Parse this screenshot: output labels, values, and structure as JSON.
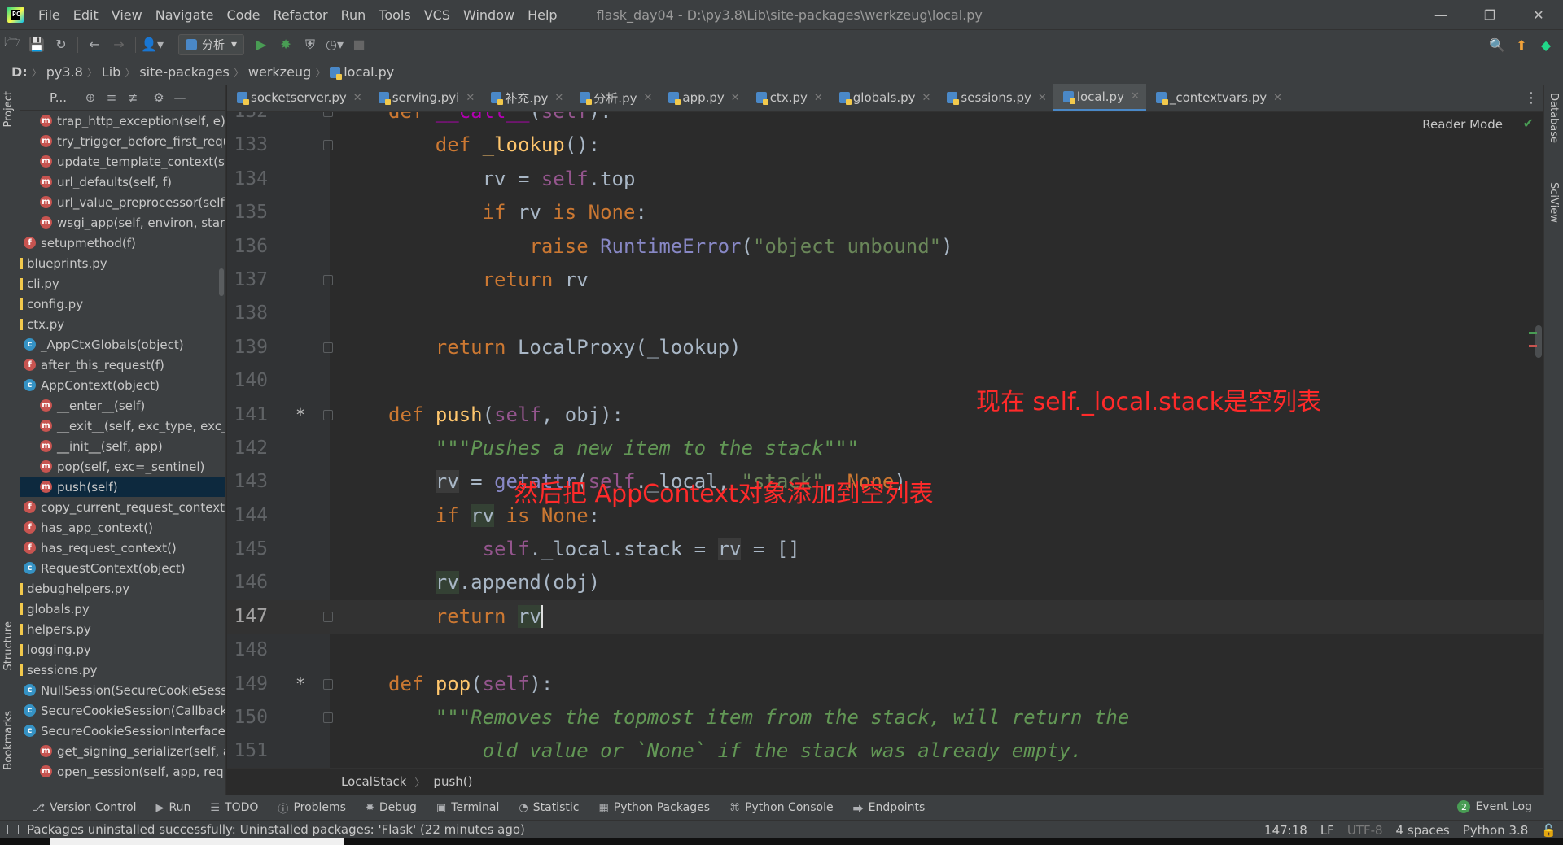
{
  "window": {
    "menu": [
      "File",
      "Edit",
      "View",
      "Navigate",
      "Code",
      "Refactor",
      "Run",
      "Tools",
      "VCS",
      "Window",
      "Help"
    ],
    "title": "flask_day04 - D:\\py3.8\\Lib\\site-packages\\werkzeug\\local.py",
    "logo_text": "PC"
  },
  "toolbar": {
    "run_config": "分析",
    "icons": [
      "open-icon",
      "save-icon",
      "sync-icon",
      "back-icon",
      "forward-icon",
      "user-icon",
      "run-icon",
      "debug-icon",
      "coverage-icon",
      "profile-icon",
      "stop-icon",
      "search-icon",
      "update-icon",
      "jetbrains-icon"
    ]
  },
  "navpath": {
    "crumbs": [
      "D:",
      "py3.8",
      "Lib",
      "site-packages",
      "werkzeug",
      "local.py"
    ]
  },
  "left_strip": {
    "project": "Project",
    "structure": "Structure",
    "bookmarks": "Bookmarks"
  },
  "project": {
    "header": "P...",
    "tree": [
      {
        "type": "m",
        "indent": 2,
        "label": "trap_http_exception(self, e)"
      },
      {
        "type": "m",
        "indent": 2,
        "label": "try_trigger_before_first_request"
      },
      {
        "type": "m",
        "indent": 2,
        "label": "update_template_context(self"
      },
      {
        "type": "m",
        "indent": 2,
        "label": "url_defaults(self, f)"
      },
      {
        "type": "m",
        "indent": 2,
        "label": "url_value_preprocessor(self"
      },
      {
        "type": "m",
        "indent": 2,
        "label": "wsgi_app(self, environ, start"
      },
      {
        "type": "f",
        "indent": 1,
        "label": "setupmethod(f)"
      },
      {
        "type": "file",
        "indent": 0,
        "label": "blueprints.py"
      },
      {
        "type": "file",
        "indent": 0,
        "label": "cli.py"
      },
      {
        "type": "file",
        "indent": 0,
        "label": "config.py"
      },
      {
        "type": "file",
        "indent": 0,
        "label": "ctx.py"
      },
      {
        "type": "c",
        "indent": 1,
        "label": "_AppCtxGlobals(object)"
      },
      {
        "type": "f",
        "indent": 1,
        "label": "after_this_request(f)"
      },
      {
        "type": "c",
        "indent": 1,
        "label": "AppContext(object)"
      },
      {
        "type": "m",
        "indent": 2,
        "label": "__enter__(self)"
      },
      {
        "type": "m",
        "indent": 2,
        "label": "__exit__(self, exc_type, exc_"
      },
      {
        "type": "m",
        "indent": 2,
        "label": "__init__(self, app)"
      },
      {
        "type": "m",
        "indent": 2,
        "label": "pop(self, exc=_sentinel)"
      },
      {
        "type": "m",
        "indent": 2,
        "label": "push(self)",
        "selected": true
      },
      {
        "type": "f",
        "indent": 1,
        "label": "copy_current_request_context"
      },
      {
        "type": "f",
        "indent": 1,
        "label": "has_app_context()"
      },
      {
        "type": "f",
        "indent": 1,
        "label": "has_request_context()"
      },
      {
        "type": "c",
        "indent": 1,
        "label": "RequestContext(object)"
      },
      {
        "type": "file",
        "indent": 0,
        "label": "debughelpers.py"
      },
      {
        "type": "file",
        "indent": 0,
        "label": "globals.py"
      },
      {
        "type": "file",
        "indent": 0,
        "label": "helpers.py"
      },
      {
        "type": "file",
        "indent": 0,
        "label": "logging.py"
      },
      {
        "type": "file",
        "indent": 0,
        "label": "sessions.py"
      },
      {
        "type": "c",
        "indent": 1,
        "label": "NullSession(SecureCookieSess"
      },
      {
        "type": "c",
        "indent": 1,
        "label": "SecureCookieSession(Callback"
      },
      {
        "type": "c",
        "indent": 1,
        "label": "SecureCookieSessionInterface"
      },
      {
        "type": "m",
        "indent": 2,
        "label": "get_signing_serializer(self, a"
      },
      {
        "type": "m",
        "indent": 2,
        "label": "open_session(self, app, req"
      }
    ]
  },
  "tabs": [
    {
      "label": "socketserver.py",
      "active": false
    },
    {
      "label": "serving.pyi",
      "active": false
    },
    {
      "label": "补充.py",
      "active": false
    },
    {
      "label": "分析.py",
      "active": false
    },
    {
      "label": "app.py",
      "active": false
    },
    {
      "label": "ctx.py",
      "active": false
    },
    {
      "label": "globals.py",
      "active": false
    },
    {
      "label": "sessions.py",
      "active": false
    },
    {
      "label": "local.py",
      "active": true
    },
    {
      "label": "_contextvars.py",
      "active": false
    }
  ],
  "editor": {
    "reader_mode": "Reader Mode",
    "current_line": 147,
    "lines": [
      {
        "n": "132",
        "mark": "*",
        "fold": true,
        "html": "    <span class='kw'>def</span> <span class='dunder'>__call__</span>(<span class='self'>self</span>):"
      },
      {
        "n": "133",
        "mark": "",
        "fold": true,
        "html": "        <span class='kw'>def</span> <span class='fn'>_lookup</span>():"
      },
      {
        "n": "134",
        "mark": "",
        "fold": false,
        "html": "            rv = <span class='self'>self</span>.top"
      },
      {
        "n": "135",
        "mark": "",
        "fold": false,
        "html": "            <span class='kw'>if</span> rv <span class='kw'>is</span> <span class='kw'>None</span>:"
      },
      {
        "n": "136",
        "mark": "",
        "fold": false,
        "html": "                <span class='kw'>raise</span> <span class='bi'>RuntimeError</span>(<span class='str'>\"object unbound\"</span>)"
      },
      {
        "n": "137",
        "mark": "",
        "fold": true,
        "html": "            <span class='kw'>return</span> rv"
      },
      {
        "n": "138",
        "mark": "",
        "fold": false,
        "html": ""
      },
      {
        "n": "139",
        "mark": "",
        "fold": true,
        "html": "        <span class='kw'>return</span> LocalProxy(_lookup)"
      },
      {
        "n": "140",
        "mark": "",
        "fold": false,
        "html": ""
      },
      {
        "n": "141",
        "mark": "*",
        "fold": true,
        "html": "    <span class='kw'>def</span> <span class='fn'>push</span>(<span class='self'>self</span>, obj):"
      },
      {
        "n": "142",
        "mark": "",
        "fold": false,
        "html": "        <span class='doc'>\"\"\"Pushes a new item to the stack\"\"\"</span>"
      },
      {
        "n": "143",
        "mark": "",
        "fold": false,
        "html": "        <span class='hl2'>rv</span> = <span class='bi'>getattr</span>(<span class='self'>self</span>._local, <span class='str'>\"stack\"</span>, <span class='kw'>None</span>)"
      },
      {
        "n": "144",
        "mark": "",
        "fold": false,
        "html": "        <span class='kw'>if</span> <span class='hl'>rv</span> <span class='kw'>is</span> <span class='kw'>None</span>:"
      },
      {
        "n": "145",
        "mark": "",
        "fold": false,
        "html": "            <span class='self'>self</span>._local.stack = <span class='hl2'>rv</span> = []"
      },
      {
        "n": "146",
        "mark": "",
        "fold": false,
        "html": "        <span class='hl'>rv</span>.append(obj)"
      },
      {
        "n": "147",
        "mark": "",
        "fold": true,
        "html": "        <span class='kw'>return</span> <span class='hl caret'>rv</span>"
      },
      {
        "n": "148",
        "mark": "",
        "fold": false,
        "html": ""
      },
      {
        "n": "149",
        "mark": "*",
        "fold": true,
        "html": "    <span class='kw'>def</span> <span class='fn'>pop</span>(<span class='self'>self</span>):"
      },
      {
        "n": "150",
        "mark": "",
        "fold": true,
        "html": "        <span class='doc'>\"\"\"Removes the topmost item from the stack, will return the</span>"
      },
      {
        "n": "151",
        "mark": "",
        "fold": false,
        "html": "<span class='doc'>        old value or `None` if the stack was already empty.</span>"
      }
    ],
    "annotations": [
      {
        "text": "现在 self._local.stack是空列表",
        "line": 11
      },
      {
        "text": "然后把 AppContext对象添加到空列表",
        "line": 14
      }
    ]
  },
  "editor_breadcrumb": [
    "LocalStack",
    "push()"
  ],
  "right_strip": {
    "database": "Database",
    "sciview": "SciView"
  },
  "toolwindows": [
    {
      "label": "Version Control",
      "icon": "version-control-icon"
    },
    {
      "label": "Run",
      "icon": "run-icon"
    },
    {
      "label": "TODO",
      "icon": "todo-icon"
    },
    {
      "label": "Problems",
      "icon": "problems-icon"
    },
    {
      "label": "Debug",
      "icon": "debug-icon"
    },
    {
      "label": "Terminal",
      "icon": "terminal-icon"
    },
    {
      "label": "Statistic",
      "icon": "statistic-icon"
    },
    {
      "label": "Python Packages",
      "icon": "packages-icon"
    },
    {
      "label": "Python Console",
      "icon": "console-icon"
    },
    {
      "label": "Endpoints",
      "icon": "endpoints-icon"
    }
  ],
  "event_log": {
    "count": "2",
    "label": "Event Log"
  },
  "status": {
    "message": "Packages uninstalled successfully: Uninstalled packages: 'Flask' (22 minutes ago)",
    "position": "147:18",
    "line_sep": "LF",
    "encoding": "UTF-8",
    "indent": "4 spaces",
    "interpreter": "Python 3.8"
  },
  "colors": {
    "accent": "#4a88c7",
    "annotation": "#ff2a2a",
    "keyword": "#cc7832",
    "function": "#ffc66d",
    "string": "#6a8759"
  }
}
